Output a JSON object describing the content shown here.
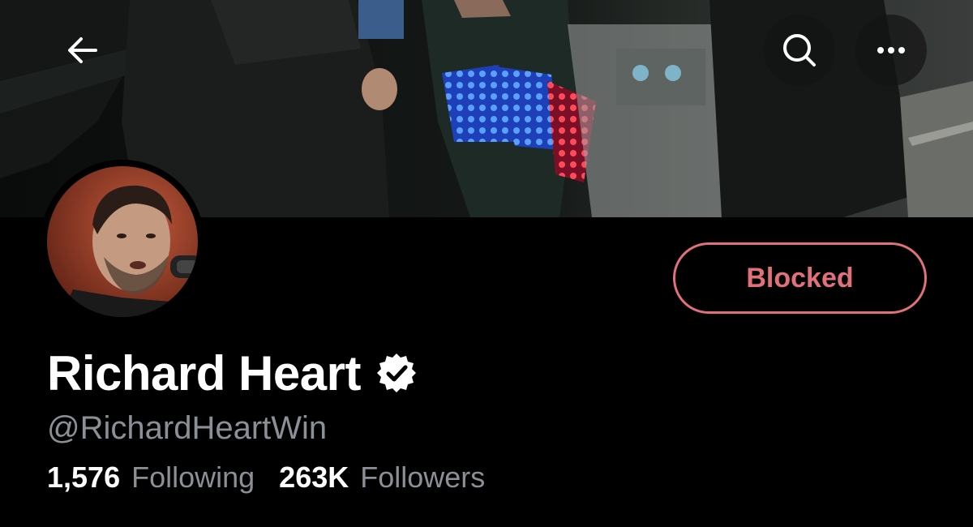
{
  "profile": {
    "display_name": "Richard Heart",
    "handle": "@RichardHeartWin",
    "verified": true
  },
  "actions": {
    "blocked_label": "Blocked"
  },
  "stats": {
    "following_count": "1,576",
    "following_label": "Following",
    "followers_count": "263K",
    "followers_label": "Followers"
  },
  "icons": {
    "back": "arrow-left-icon",
    "search": "search-icon",
    "more": "more-horizontal-icon",
    "verified": "verified-badge-icon"
  },
  "colors": {
    "background": "#000000",
    "blocked_accent": "#e0707a",
    "secondary_text": "#8b9096",
    "primary_text": "#ffffff"
  }
}
